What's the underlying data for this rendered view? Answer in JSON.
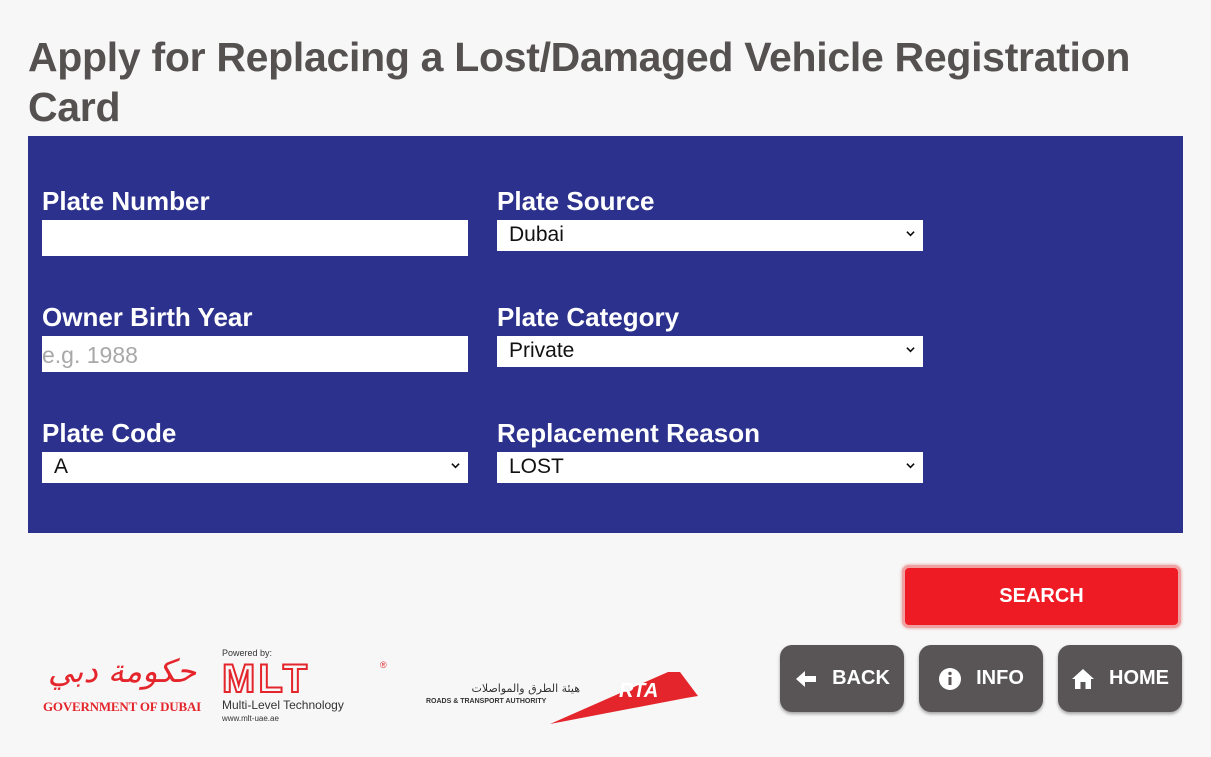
{
  "page": {
    "title": "Apply for Replacing a Lost/Damaged Vehicle Registration Card"
  },
  "form": {
    "plate_number": {
      "label": "Plate Number",
      "value": "",
      "placeholder": ""
    },
    "plate_source": {
      "label": "Plate Source",
      "selected": "Dubai"
    },
    "owner_birth_year": {
      "label": "Owner Birth Year",
      "value": "",
      "placeholder": "e.g. 1988"
    },
    "plate_category": {
      "label": "Plate Category",
      "selected": "Private"
    },
    "plate_code": {
      "label": "Plate Code",
      "selected": "A"
    },
    "replacement_reason": {
      "label": "Replacement Reason",
      "selected": "LOST"
    }
  },
  "actions": {
    "search_label": "SEARCH",
    "back_label": "BACK",
    "info_label": "INFO",
    "home_label": "HOME"
  },
  "footer": {
    "gov_dubai": {
      "arabic": "حكومة دبي",
      "english": "GOVERNMENT OF DUBAI"
    },
    "mlt": {
      "powered_by": "Powered by:",
      "name": "MLT",
      "tagline": "Multi-Level Technology",
      "url": "www.mlt-uae.ae"
    },
    "rta": {
      "arabic": "هيئة الطرق والمواصلات",
      "english": "ROADS & TRANSPORT AUTHORITY",
      "name": "RTA"
    }
  },
  "colors": {
    "panel": "#2b318c",
    "search": "#ee1b24",
    "nav": "#595556",
    "title": "#555151",
    "brand_red": "#e4262c"
  },
  "icons": {
    "back": "arrow-left-icon",
    "info": "info-circle-icon",
    "home": "house-icon",
    "select": "chevron-down-icon"
  }
}
